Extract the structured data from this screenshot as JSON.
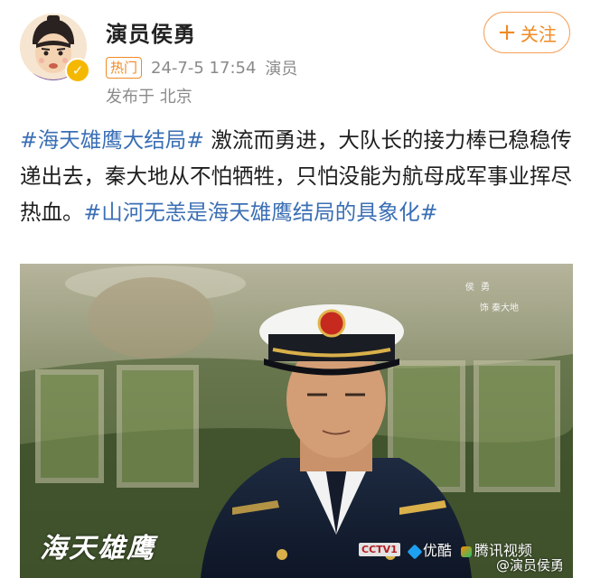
{
  "post": {
    "author": "演员侯勇",
    "hot_badge": "热门",
    "timestamp": "24-7-5 17:54",
    "source": "演员",
    "location": "发布于 北京",
    "follow_button": "关注",
    "follow_icon": "plus-icon",
    "verified_icon": "verified-badge-icon",
    "text_segments": [
      {
        "type": "tag",
        "text": "#海天雄鹰大结局#"
      },
      {
        "type": "text",
        "text": " 激流而勇进，大队长的接力棒已稳稳传递出去，秦大地从不怕牺牲，只怕没能为航母成军事业挥尽热血。"
      },
      {
        "type": "tag",
        "text": "#山河无恙是海天雄鹰结局的具象化#"
      }
    ]
  },
  "poster": {
    "credit_name": "侯 勇",
    "credit_role": "饰 秦大地",
    "show_title": "海天雄鹰",
    "platforms": [
      "CCTV1",
      "优酷",
      "腾讯视频"
    ],
    "watermark": "@演员侯勇"
  },
  "colors": {
    "tag_blue": "#3b6fb5",
    "accent_orange": "#f08a24",
    "meta_gray": "#8a8a8a"
  }
}
